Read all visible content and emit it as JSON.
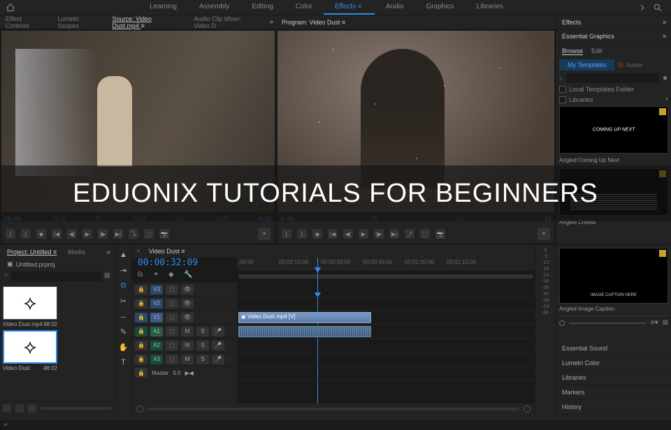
{
  "topbar": {
    "workspaces": [
      "Learning",
      "Assembly",
      "Editing",
      "Color",
      "Effects",
      "Audio",
      "Graphics",
      "Libraries"
    ],
    "active_workspace": "Effects"
  },
  "source_panel": {
    "tabs": [
      "Effect Controls",
      "Lumetri Scopes",
      "Source: Video Dust.mp4",
      "Audio Clip Mixer: Video D"
    ],
    "active_tab": "Source: Video Dust.mp4",
    "timecode_current": "00:00",
    "ruler_start": "01",
    "ruler_labels": [
      ":15:00",
      ":30:00",
      ":45:00"
    ],
    "fit_label": "Fit",
    "half_label": "1/2",
    "duration": ""
  },
  "program_panel": {
    "title": "Program: Video Dust",
    "fit_label": "Fit",
    "half_label": "1/2"
  },
  "effects_panel": {
    "title": "Effects"
  },
  "graphics_panel": {
    "title": "Essential Graphics",
    "tabs": [
      "Browse",
      "Edit"
    ],
    "active_tab": "Browse",
    "my_templates": "My Templates",
    "adobe_label": "Adobe",
    "stock_icon": "St",
    "search_placeholder": "",
    "local_folder": "Local Templates Folder",
    "libraries_label": "Libraries",
    "templates": [
      {
        "title": "COMING UP NEXT",
        "label": "Angled Coming Up Next"
      },
      {
        "title": "",
        "label": "Angled Credits"
      },
      {
        "title": "IMAGE CAPTION HERE",
        "label": "Angled Image Caption"
      }
    ]
  },
  "project_panel": {
    "title": "Project: Untitled",
    "media_tab": "Media",
    "project_file": "Untitled.prproj",
    "search_placeholder": "",
    "items": [
      {
        "name": "Video Dust.mp4",
        "duration": "48:02",
        "selected": false
      },
      {
        "name": "Video Dust",
        "duration": "48:02",
        "selected": true
      }
    ]
  },
  "timeline": {
    "sequence_name": "Video Dust",
    "timecode": "00:00:32:09",
    "ruler": [
      ":00:00",
      "00:00:15:00",
      "00:00:30:00",
      "00:00:45:00",
      "00:01:00:00",
      "00:01:15:00"
    ],
    "video_tracks": [
      {
        "id": "V3",
        "lock": "lock-icon",
        "toggle": "toggle-icon"
      },
      {
        "id": "V2",
        "lock": "lock-icon",
        "toggle": "toggle-icon"
      },
      {
        "id": "V1",
        "lock": "lock-icon",
        "toggle": "toggle-icon",
        "active": true
      }
    ],
    "audio_tracks": [
      {
        "id": "A1",
        "m": "M",
        "s": "S",
        "active": true
      },
      {
        "id": "A2",
        "m": "M",
        "s": "S"
      },
      {
        "id": "A3",
        "m": "M",
        "s": "S"
      }
    ],
    "master_label": "Master",
    "master_value": "0.0",
    "clip_video_label": "Video Dust.mp4 [V]",
    "clip_audio_label": ""
  },
  "meters": {
    "ticks": [
      "0",
      "-6",
      "-12",
      "-18",
      "-24",
      "-30",
      "-36",
      "-42",
      "-48",
      "-54",
      "dB"
    ]
  },
  "accordion": {
    "items": [
      "Essential Sound",
      "Lumetri Color",
      "Libraries",
      "Markers",
      "History"
    ]
  },
  "overlay": {
    "text": "EDUONIX TUTORIALS FOR BEGINNERS"
  }
}
